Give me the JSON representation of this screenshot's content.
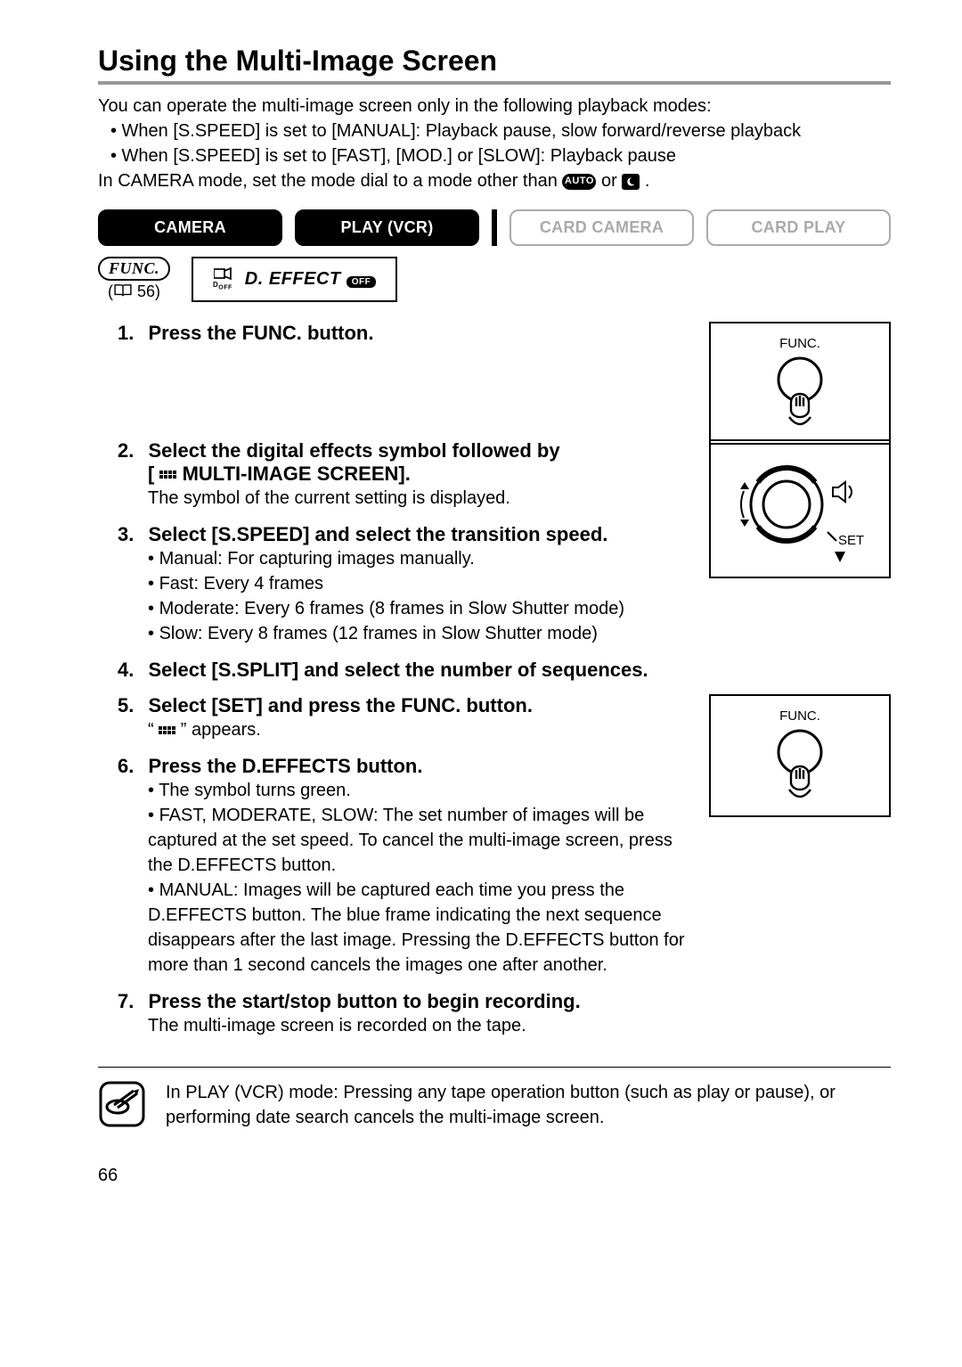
{
  "title": "Using the Multi-Image Screen",
  "intro": {
    "line1": "You can operate the multi-image screen only in the following playback modes:",
    "b1": "• When [S.SPEED] is set to [MANUAL]: Playback pause, slow forward/reverse playback",
    "b2": "• When [S.SPEED] is set to [FAST], [MOD.] or [SLOW]: Playback pause",
    "line2a": "In CAMERA mode, set the mode dial to a mode other than ",
    "line2b": " or ",
    "line2c": " .",
    "auto_label": "AUTO"
  },
  "modes": {
    "m1": "CAMERA",
    "m2": "PLAY (VCR)",
    "m3": "CARD CAMERA",
    "m4": "CARD PLAY"
  },
  "func": {
    "label": "FUNC.",
    "page": "56",
    "effect_prefix": "D. EFFECT",
    "off": "OFF",
    "d_off": "D"
  },
  "steps": {
    "s1": "Press the FUNC. button.",
    "s2a": "Select the digital effects symbol followed by",
    "s2b": "MULTI-IMAGE SCREEN].",
    "s2_sub": "The symbol of the current setting is displayed.",
    "s3": "Select [S.SPEED] and select the transition speed.",
    "s3_b1": "Manual: For capturing images manually.",
    "s3_b2": "Fast: Every 4 frames",
    "s3_b3": "Moderate: Every 6 frames (8 frames in Slow Shutter mode)",
    "s3_b4": "Slow: Every 8 frames (12 frames in Slow Shutter mode)",
    "s4": "Select [S.SPLIT] and select the number of sequences.",
    "s5": "Select [SET] and press the FUNC. button.",
    "s5_sub_a": "“ ",
    "s5_sub_b": " ” appears.",
    "s6": "Press the D.EFFECTS button.",
    "s6_b1": "The symbol turns green.",
    "s6_b2": "FAST, MODERATE, SLOW: The set number of images will be captured at the set speed. To cancel the multi-image screen, press the D.EFFECTS button.",
    "s6_b3": "MANUAL: Images will be captured each time you press the D.EFFECTS button. The blue frame indicating the next sequence disappears after the last image. Pressing the D.EFFECTS button for more than 1 second cancels the images one after another.",
    "s7": "Press the start/stop button to begin recording.",
    "s7_sub": "The multi-image screen is recorded on the tape."
  },
  "diagram": {
    "func": "FUNC.",
    "set": "SET"
  },
  "note": "In PLAY (VCR) mode: Pressing any tape operation button (such as play or pause), or performing date search cancels the multi-image screen.",
  "page_number": "66"
}
